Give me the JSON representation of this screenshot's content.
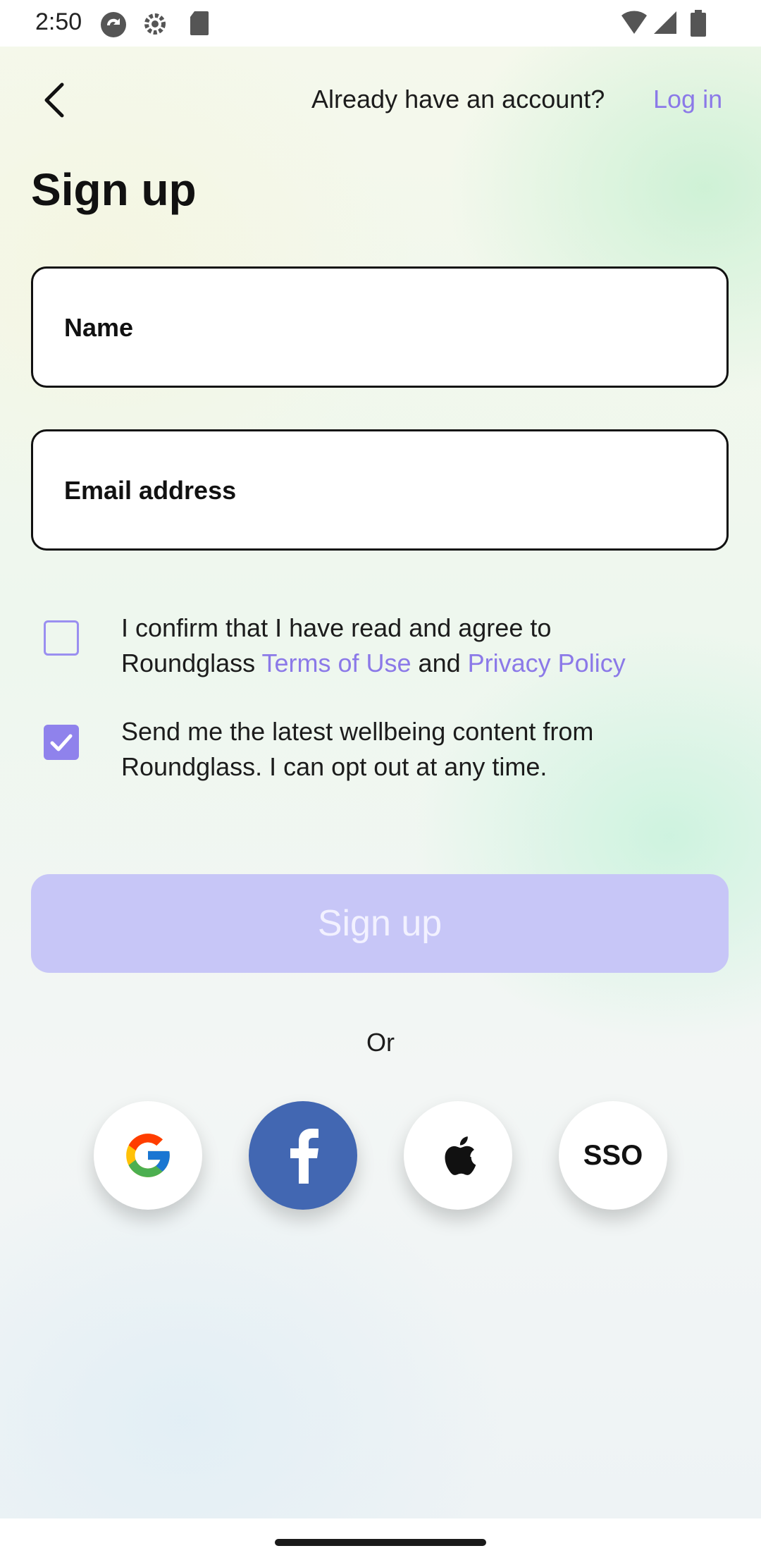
{
  "status_bar": {
    "time": "2:50"
  },
  "header": {
    "already_text": "Already have an account?",
    "login_label": "Log in"
  },
  "page_title": "Sign up",
  "form": {
    "name_placeholder": "Name",
    "email_placeholder": "Email address"
  },
  "consent": {
    "terms": {
      "checked": false,
      "text_line1": "I confirm that I have read and agree to",
      "text_prefix": "Roundglass",
      "terms_link": "Terms of Use",
      "and": "and",
      "privacy_link": "Privacy Policy"
    },
    "newsletter": {
      "checked": true,
      "text": "Send me the latest wellbeing content from Roundglass. I can opt out at any time."
    }
  },
  "signup_button_label": "Sign up",
  "or_label": "Or",
  "social": {
    "google_icon": "google-icon",
    "facebook_icon": "facebook-icon",
    "apple_icon": "apple-icon",
    "sso_label": "SSO"
  },
  "colors": {
    "accent": "#8b79e8",
    "button_disabled": "#c7c6f7",
    "facebook": "#4267b2"
  }
}
